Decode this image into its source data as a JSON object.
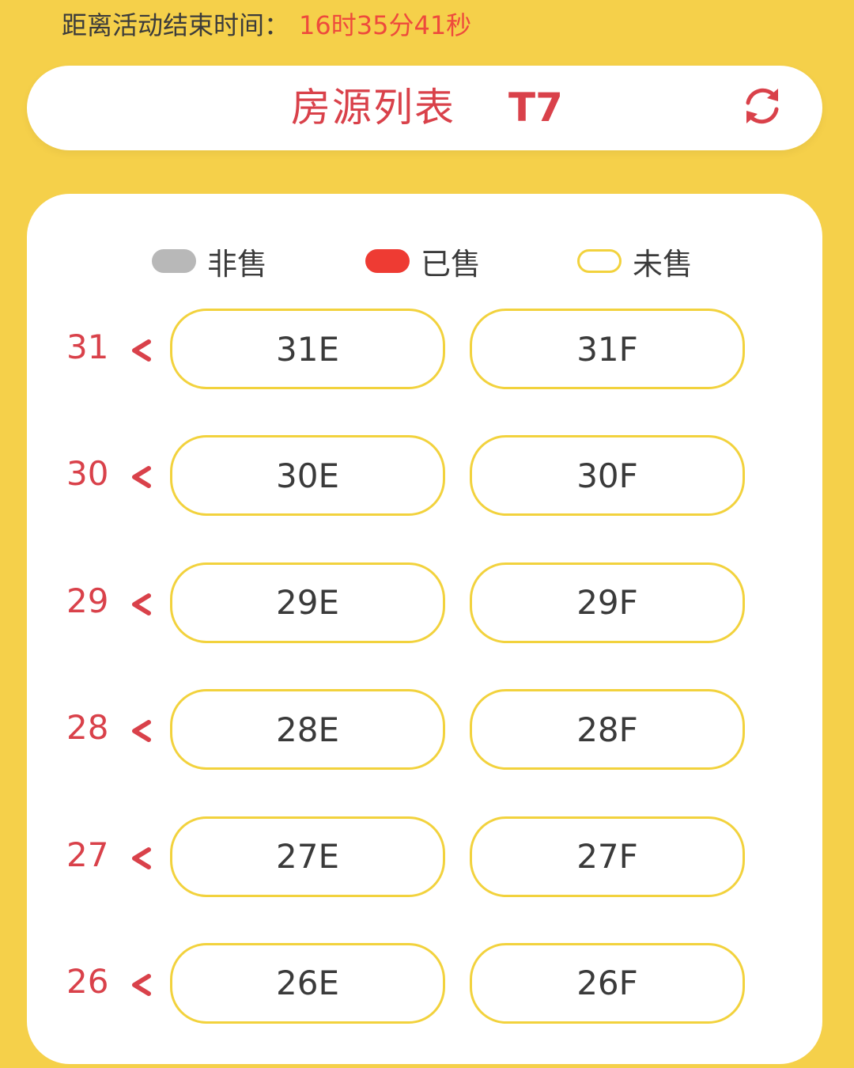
{
  "countdown": {
    "label": "距离活动结束时间：",
    "time": "16时35分41秒"
  },
  "header": {
    "title": "房源列表",
    "building": "T7",
    "refresh_icon": "refresh-icon"
  },
  "legend": [
    {
      "label": "非售",
      "color": "#b8b8b8",
      "style": "filled"
    },
    {
      "label": "已售",
      "color": "#ee3b33",
      "style": "filled"
    },
    {
      "label": "未售",
      "color": "#f2d23d",
      "style": "outline"
    }
  ],
  "floors": [
    {
      "floor": "31",
      "units": [
        "31E",
        "31F"
      ]
    },
    {
      "floor": "30",
      "units": [
        "30E",
        "30F"
      ]
    },
    {
      "floor": "29",
      "units": [
        "29E",
        "29F"
      ]
    },
    {
      "floor": "28",
      "units": [
        "28E",
        "28F"
      ]
    },
    {
      "floor": "27",
      "units": [
        "27E",
        "27F"
      ]
    },
    {
      "floor": "26",
      "units": [
        "26E",
        "26F"
      ]
    }
  ],
  "colors": {
    "background": "#f5d04a",
    "accent_red": "#d9414a",
    "countdown_red": "#ee4a3c",
    "unit_border": "#f2d23d"
  }
}
